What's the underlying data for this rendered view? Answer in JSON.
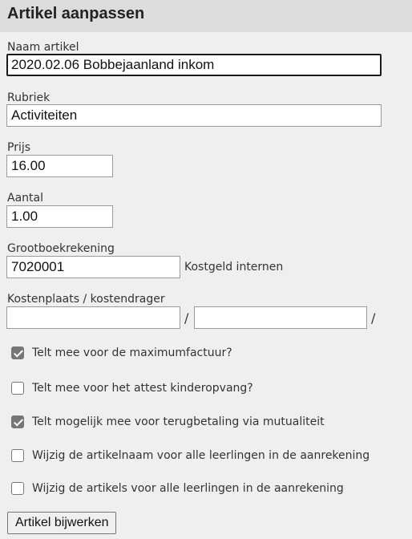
{
  "header": {
    "title": "Artikel aanpassen"
  },
  "fields": {
    "naam": {
      "label": "Naam artikel",
      "value": "2020.02.06 Bobbejaanland inkom"
    },
    "rubriek": {
      "label": "Rubriek",
      "value": "Activiteiten"
    },
    "prijs": {
      "label": "Prijs",
      "value": "16.00"
    },
    "aantal": {
      "label": "Aantal",
      "value": "1.00"
    },
    "grootboek": {
      "label": "Grootboekrekening",
      "value": "7020001",
      "description": "Kostgeld internen"
    },
    "kostenplaats": {
      "label": "Kostenplaats / kostendrager",
      "value1": "",
      "value2": "",
      "separator": "/"
    }
  },
  "checkboxes": [
    {
      "label": "Telt mee voor de maximumfactuur?",
      "checked": true
    },
    {
      "label": "Telt mee voor het attest kinderopvang?",
      "checked": false
    },
    {
      "label": "Telt mogelijk mee voor terugbetaling via mutualiteit",
      "checked": true
    },
    {
      "label": "Wijzig de artikelnaam voor alle leerlingen in de aanrekening",
      "checked": false
    },
    {
      "label": "Wijzig de artikels voor alle leerlingen in de aanrekening",
      "checked": false
    }
  ],
  "submit": {
    "label": "Artikel bijwerken"
  }
}
